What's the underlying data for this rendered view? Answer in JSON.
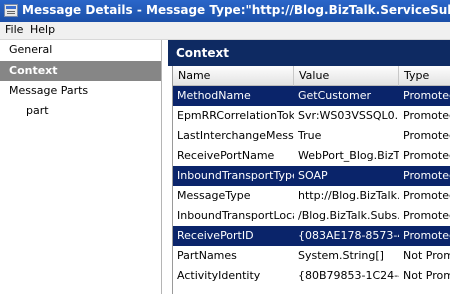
{
  "window": {
    "title": "Message Details - Message Type:\"http://Blog.BizTalk.ServiceSubscriptionTest#Cust"
  },
  "menu": [
    "File",
    "Help"
  ],
  "nav": [
    "General",
    "Context",
    "Message Parts",
    "part"
  ],
  "context": {
    "header": "Context",
    "columns": [
      "Name",
      "Value",
      "Type"
    ],
    "rows": [
      {
        "name": "MethodName",
        "value": "GetCustomer",
        "type": "Promoted",
        "selected": true
      },
      {
        "name": "EpmRRCorrelationToken",
        "value": "Svr:WS03VSSQL0...",
        "type": "Promoted",
        "selected": false
      },
      {
        "name": "LastInterchangeMessage",
        "value": "True",
        "type": "Promoted",
        "selected": false
      },
      {
        "name": "ReceivePortName",
        "value": "WebPort_Blog.BizT...",
        "type": "Promoted",
        "selected": false
      },
      {
        "name": "InboundTransportType",
        "value": "SOAP",
        "type": "Promoted",
        "selected": true
      },
      {
        "name": "MessageType",
        "value": "http://Blog.BizTalk...",
        "type": "Promoted",
        "selected": false
      },
      {
        "name": "InboundTransportLocat...",
        "value": "/Blog.BizTalk.Subs...",
        "type": "Promoted",
        "selected": false
      },
      {
        "name": "ReceivePortID",
        "value": "{083AE178-8573-4...",
        "type": "Promoted",
        "selected": true
      },
      {
        "name": "PartNames",
        "value": "System.String[]",
        "type": "Not Promoted",
        "selected": false
      },
      {
        "name": "ActivityIdentity",
        "value": "{80B79853-1C24-4...",
        "type": "Not Promoted",
        "selected": false
      }
    ]
  }
}
